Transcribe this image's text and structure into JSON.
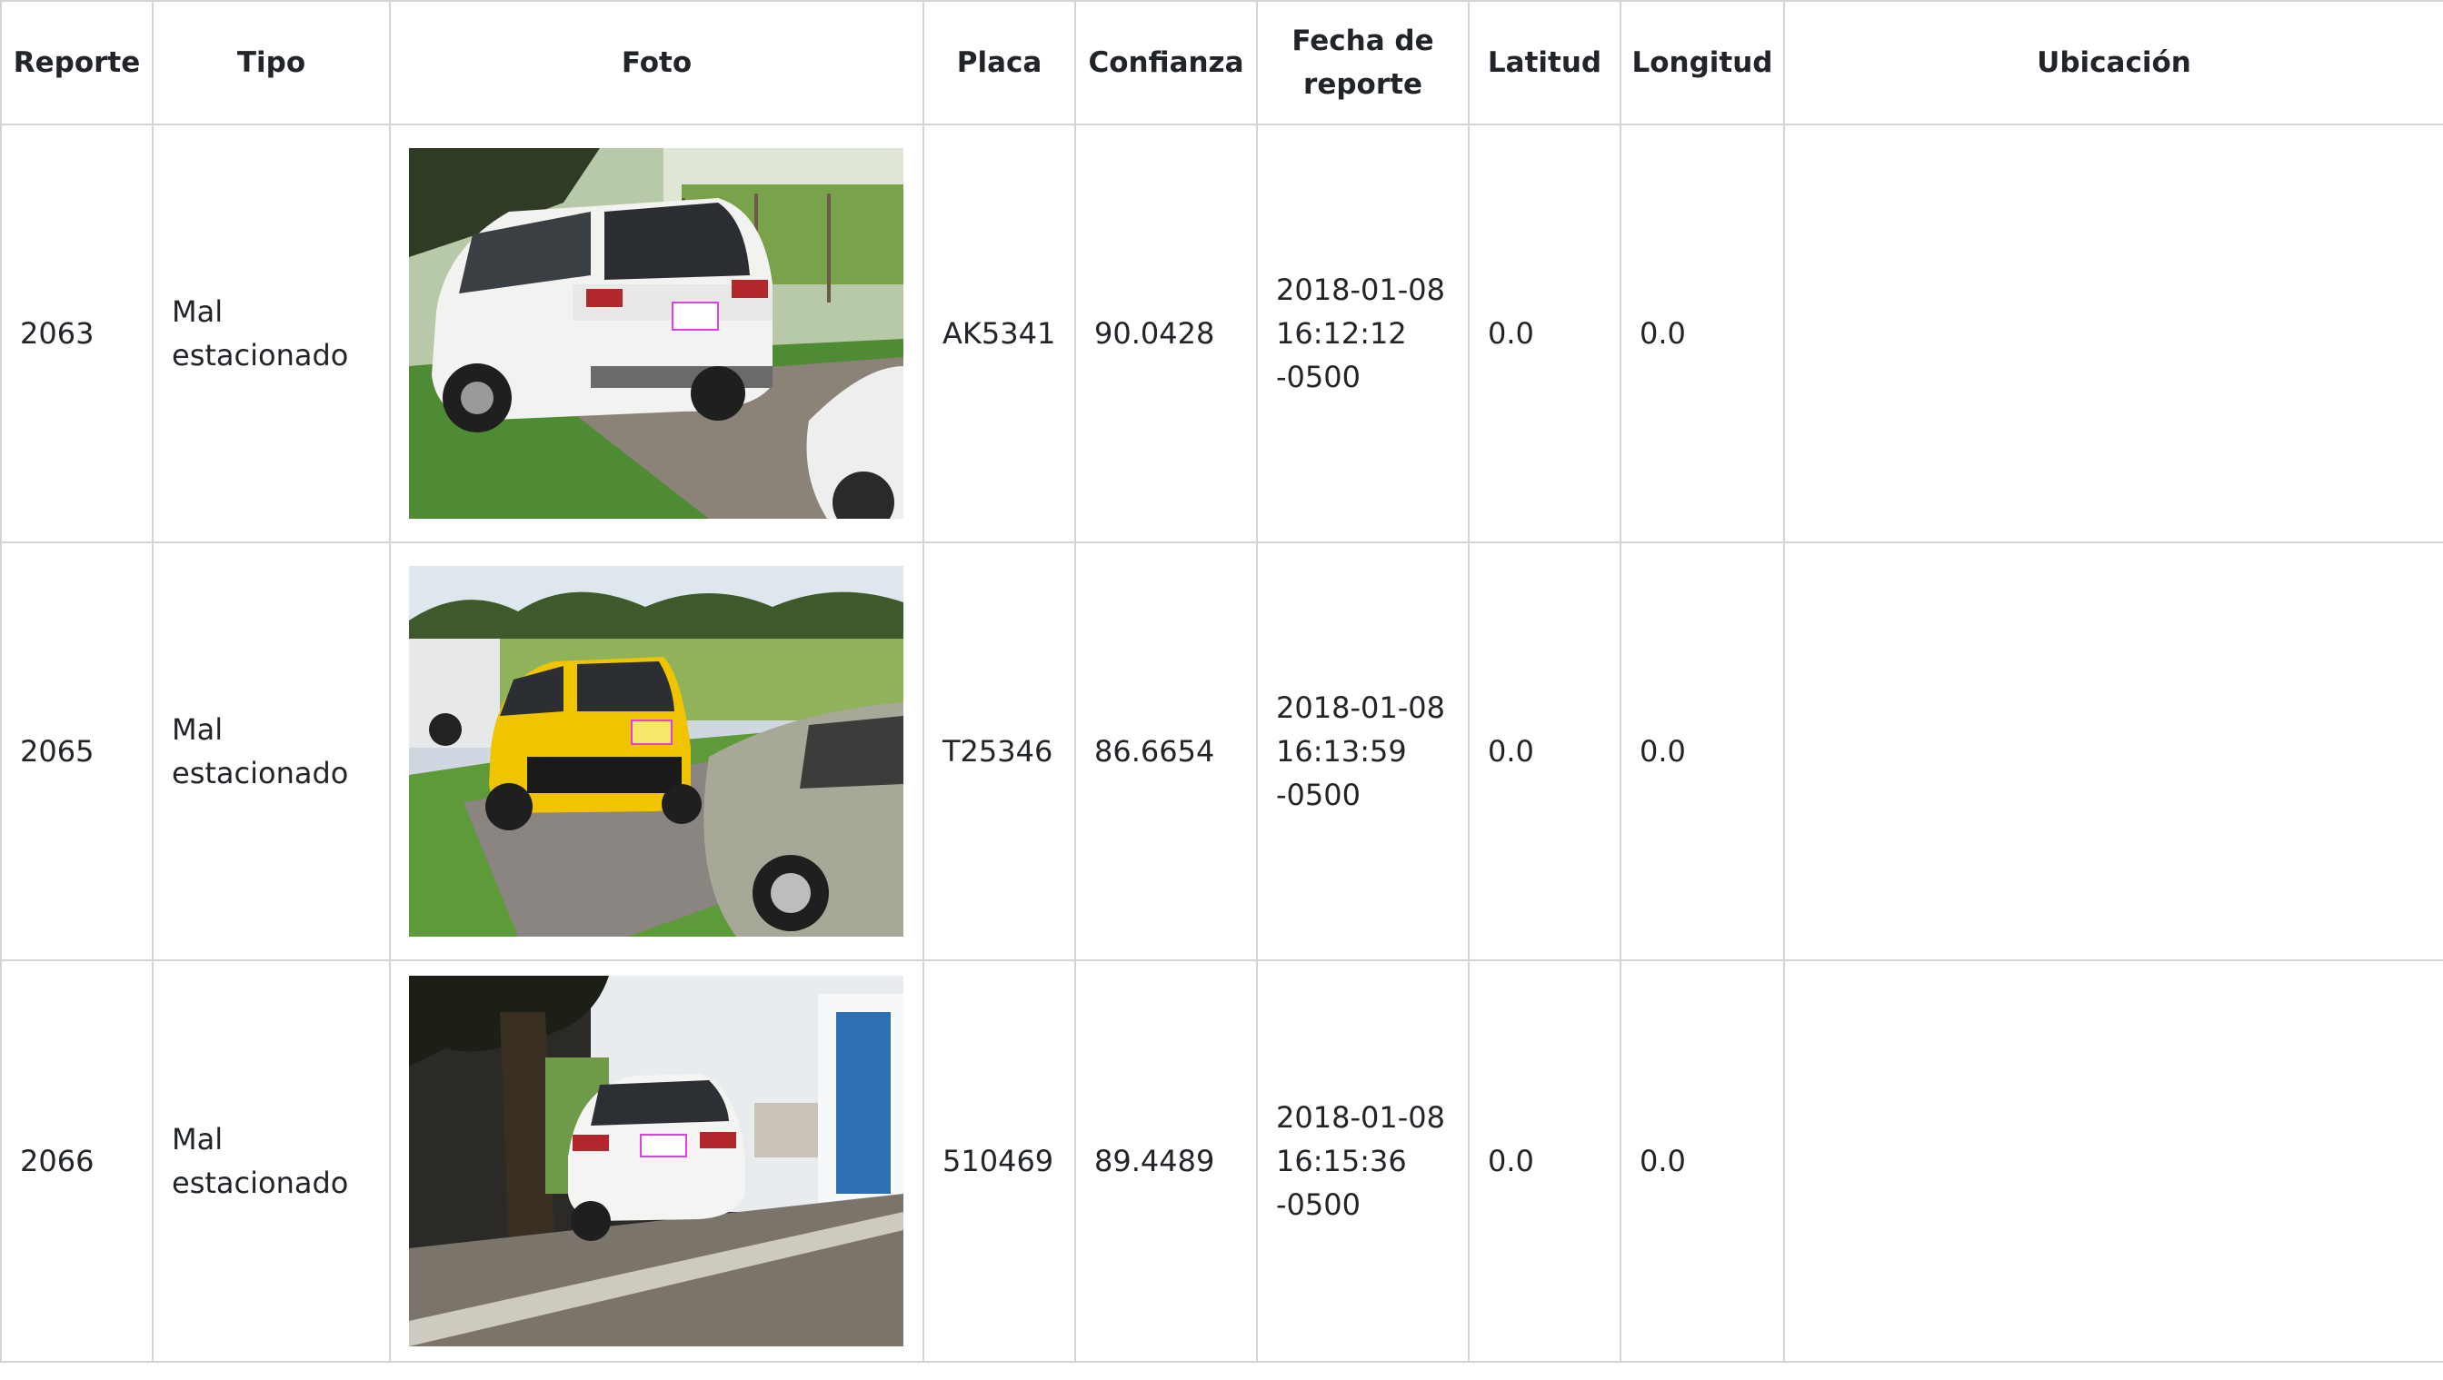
{
  "table": {
    "headers": {
      "reporte": "Reporte",
      "tipo": "Tipo",
      "foto": "Foto",
      "placa": "Placa",
      "confianza": "Confianza",
      "fecha_line1": "Fecha de",
      "fecha_line2": "reporte",
      "latitud": "Latitud",
      "longitud": "Longitud",
      "ubicacion": "Ubicación"
    },
    "rows": [
      {
        "reporte": "2063",
        "tipo_line1": "Mal",
        "tipo_line2": "estacionado",
        "placa": "AK5341",
        "confianza": "90.0428",
        "fecha_line1": "2018-01-08",
        "fecha_line2": "16:12:12",
        "fecha_line3": "-0500",
        "latitud": "0.0",
        "longitud": "0.0",
        "ubicacion": "",
        "photo": "white-suv-parked-photo"
      },
      {
        "reporte": "2065",
        "tipo_line1": "Mal",
        "tipo_line2": "estacionado",
        "placa": "T25346",
        "confianza": "86.6654",
        "fecha_line1": "2018-01-08",
        "fecha_line2": "16:13:59",
        "fecha_line3": "-0500",
        "latitud": "0.0",
        "longitud": "0.0",
        "ubicacion": "",
        "photo": "yellow-taxi-parked-photo"
      },
      {
        "reporte": "2066",
        "tipo_line1": "Mal",
        "tipo_line2": "estacionado",
        "placa": "510469",
        "confianza": "89.4489",
        "fecha_line1": "2018-01-08",
        "fecha_line2": "16:15:36",
        "fecha_line3": "-0500",
        "latitud": "0.0",
        "longitud": "0.0",
        "ubicacion": "",
        "photo": "white-sedan-parked-photo"
      }
    ]
  },
  "colors": {
    "border": "#d4d4d4",
    "text": "#212529",
    "plate_highlight": "#e040e0"
  }
}
